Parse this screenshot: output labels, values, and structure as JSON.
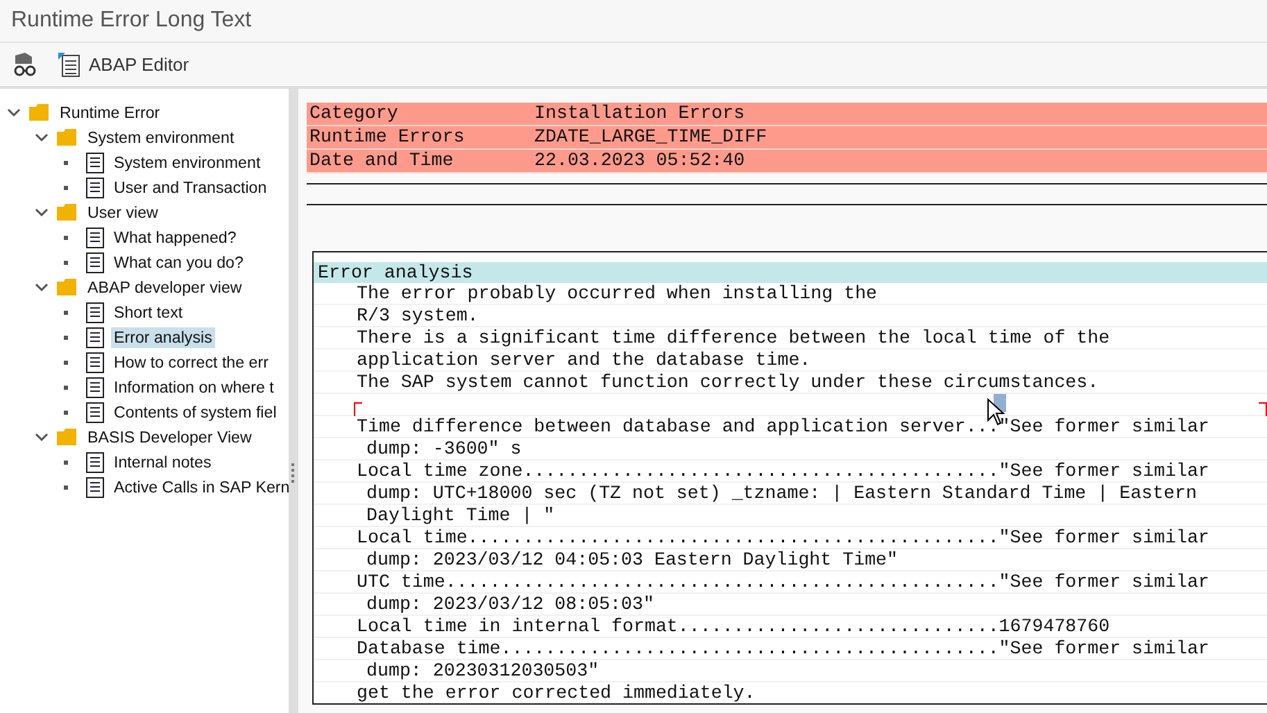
{
  "window": {
    "title": "Runtime Error Long Text"
  },
  "toolbar": {
    "items": [
      {
        "kind": "glasses"
      },
      {
        "kind": "editor",
        "label": "ABAP Editor"
      }
    ]
  },
  "tree": [
    {
      "label": "Runtime Error",
      "expanded": true,
      "children": [
        {
          "label": "System environment",
          "expanded": true,
          "children": [
            {
              "label": "System environment",
              "selected": false
            },
            {
              "label": "User and Transaction",
              "selected": false
            }
          ]
        },
        {
          "label": "User view",
          "expanded": true,
          "children": [
            {
              "label": "What happened?",
              "selected": false
            },
            {
              "label": "What can you do?",
              "selected": false
            }
          ]
        },
        {
          "label": "ABAP developer view",
          "expanded": true,
          "children": [
            {
              "label": "Short text",
              "selected": false
            },
            {
              "label": "Error analysis",
              "selected": true
            },
            {
              "label": "How to correct the err",
              "selected": false
            },
            {
              "label": "Information on where t",
              "selected": false
            },
            {
              "label": "Contents of system fiel",
              "selected": false
            }
          ]
        },
        {
          "label": "BASIS Developer View",
          "expanded": true,
          "children": [
            {
              "label": "Internal notes",
              "selected": false
            },
            {
              "label": "Active Calls in SAP Kern",
              "selected": false
            }
          ]
        }
      ]
    }
  ],
  "summary": [
    {
      "label": "Category",
      "value": "Installation Errors"
    },
    {
      "label": "Runtime Errors",
      "value": "ZDATE_LARGE_TIME_DIFF"
    },
    {
      "label": "Date and Time",
      "value": "22.03.2023 05:52:40"
    }
  ],
  "section": {
    "title": "Error analysis",
    "lines": [
      {
        "kind": "text",
        "text": "The error probably occurred when installing the"
      },
      {
        "kind": "text",
        "text": "R/3 system."
      },
      {
        "kind": "text",
        "text": "There is a significant time difference between the local time of the"
      },
      {
        "kind": "text",
        "text": "application server and the database time."
      },
      {
        "kind": "text",
        "text": "The SAP system cannot function correctly under these circumstances."
      },
      {
        "kind": "cursor"
      },
      {
        "kind": "text",
        "text": "Time difference between database and application server...\"See former similar"
      },
      {
        "kind": "continuation",
        "text": "dump: -3600\" s"
      },
      {
        "kind": "text",
        "text": "Local time zone...........................................\"See former similar"
      },
      {
        "kind": "continuation",
        "text": "dump: UTC+18000 sec (TZ not set) _tzname: | Eastern Standard Time | Eastern"
      },
      {
        "kind": "continuation",
        "text": "Daylight Time | \""
      },
      {
        "kind": "text",
        "text": "Local time................................................\"See former similar"
      },
      {
        "kind": "continuation",
        "text": "dump: 2023/03/12 04:05:03 Eastern Daylight Time\""
      },
      {
        "kind": "text",
        "text": "UTC time..................................................\"See former similar"
      },
      {
        "kind": "continuation",
        "text": "dump: 2023/03/12 08:05:03\""
      },
      {
        "kind": "text",
        "text": "Local time in internal format.............................1679478760"
      },
      {
        "kind": "text",
        "text": "Database time.............................................\"See former similar"
      },
      {
        "kind": "continuation",
        "text": "dump: 20230312030503\""
      },
      {
        "kind": "text",
        "text": "get the error corrected immediately."
      }
    ]
  }
}
